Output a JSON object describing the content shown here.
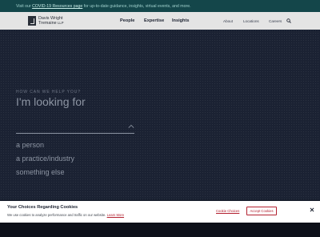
{
  "announcement": {
    "before": "Visit our",
    "link": "COVID-19 Resources page",
    "after": "for up-to-date guidance, insights, virtual events, and more."
  },
  "brand": {
    "name_line1": "Davis Wright",
    "name_line2": "Tremaine",
    "suffix": "LLP"
  },
  "nav": {
    "main": [
      "People",
      "Expertise",
      "Insights"
    ],
    "utility": [
      "About",
      "Locations",
      "Careers"
    ]
  },
  "hero": {
    "eyebrow": "HOW CAN WE HELP YOU?",
    "headline": "I'm looking for",
    "options": [
      "a person",
      "a practice/industry",
      "something else"
    ]
  },
  "cookie_banner": {
    "title": "Your Choices Regarding Cookies",
    "description": "We use cookies to analyze performance and traffic on our website.",
    "learn_more": "Learn More",
    "settings": "Cookie Choices",
    "accept": "Accept Cookies"
  },
  "icons": [
    "search-icon",
    "chevron-up-icon",
    "close-icon"
  ]
}
